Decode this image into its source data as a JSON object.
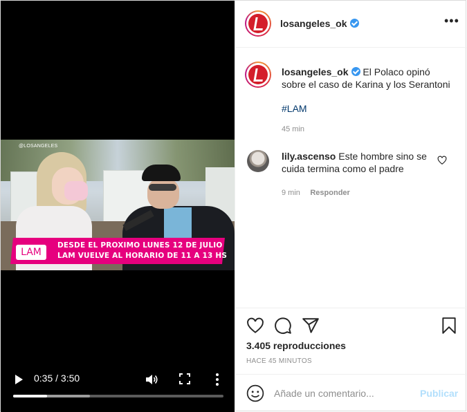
{
  "video": {
    "watermark": "@LOSANGELES",
    "banner_logo": "LAM",
    "banner_line1": "DESDE EL PROXIMO LUNES 12 DE JULIO",
    "banner_line2": "LAM VUELVE AL HORARIO DE 11 A 13 HS",
    "time_display": "0:35 / 3:50",
    "progress_played": 0.16,
    "progress_buffered": 0.365,
    "icons": [
      "play-icon",
      "volume-icon",
      "fullscreen-icon",
      "more-vertical-icon"
    ]
  },
  "header": {
    "username": "losangeles_ok",
    "verified": true,
    "more_label": "•••"
  },
  "caption": {
    "username": "losangeles_ok",
    "text": "El Polaco opinó sobre el caso de Karina y los Serantoni",
    "hashtag": "#LAM",
    "time": "45 min"
  },
  "comment": {
    "username": "lily.ascenso",
    "text": "Este hombre sino se cuida termina como el padre",
    "time": "9 min",
    "reply_label": "Responder"
  },
  "actions": {
    "icons": [
      "heart-icon",
      "comment-icon",
      "share-icon",
      "bookmark-icon"
    ],
    "views": "3.405 reproducciones",
    "posted_ago": "HACE 45 MINUTOS"
  },
  "add_comment": {
    "placeholder": "Añade un comentario...",
    "publish_label": "Publicar"
  },
  "colors": {
    "verified": "#3897f0",
    "hashtag": "#00376b",
    "publish_disabled": "#b2dffc",
    "banner": "#e6007e"
  }
}
